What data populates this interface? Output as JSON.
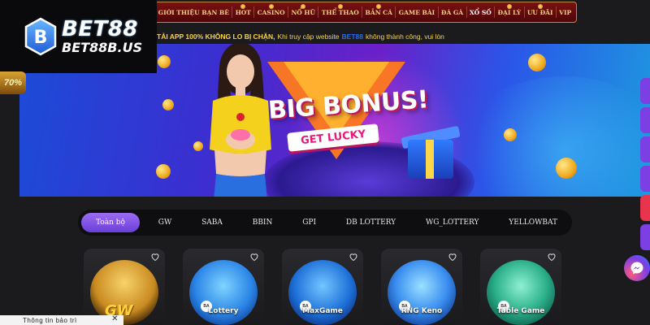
{
  "brand": {
    "logo_main": "BET88",
    "logo_sub": "BET88B.US"
  },
  "nav": {
    "items": [
      {
        "label": "GIỚI THIỆU BẠN BÈ",
        "active": false
      },
      {
        "label": "HOT",
        "active": false
      },
      {
        "label": "CASINO",
        "active": false
      },
      {
        "label": "NỔ HŨ",
        "active": false
      },
      {
        "label": "THỂ THAO",
        "active": false
      },
      {
        "label": "BẮN CÁ",
        "active": false
      },
      {
        "label": "GAME BÀI",
        "active": false
      },
      {
        "label": "ĐÁ GÀ",
        "active": false
      },
      {
        "label": "XỔ SỐ",
        "active": true
      },
      {
        "label": "ĐẠI LÝ",
        "active": false
      },
      {
        "label": "ƯU ĐÃI",
        "active": false
      },
      {
        "label": "VIP",
        "active": false
      }
    ]
  },
  "marquee": {
    "part1": "TẢI APP 100% KHÔNG LO BỊ CHẶN,",
    "part2": "Khi truy cập website",
    "brand": "BET88",
    "part3": "không thành công, vui lòn"
  },
  "left_badge": "70%",
  "banner": {
    "headline": "BIG BONUS!",
    "button": "GET LUCKY"
  },
  "tabs": [
    {
      "label": "Toàn bộ",
      "active": true
    },
    {
      "label": "GW",
      "active": false
    },
    {
      "label": "SABA",
      "active": false
    },
    {
      "label": "BBIN",
      "active": false
    },
    {
      "label": "GPI",
      "active": false
    },
    {
      "label": "DB LOTTERY",
      "active": false
    },
    {
      "label": "WG_LOTTERY",
      "active": false
    },
    {
      "label": "YELLOWBAT",
      "active": false
    }
  ],
  "games": [
    {
      "label": "",
      "badge": "GW"
    },
    {
      "label": "Lottery",
      "badge": "BA"
    },
    {
      "label": "MaxGame",
      "badge": "BA"
    },
    {
      "label": "RNG Keno",
      "badge": "BA"
    },
    {
      "label": "Table Game",
      "badge": "BA"
    }
  ],
  "infobar": {
    "text": "Thông tin bảo trì",
    "close": "✕"
  },
  "colors": {
    "nav_bg": "#7a1012",
    "nav_text": "#f4d27a",
    "tab_active": "#7b4ae0",
    "marquee_text": "#f7d34a",
    "page_bg": "#1b1b1d"
  }
}
